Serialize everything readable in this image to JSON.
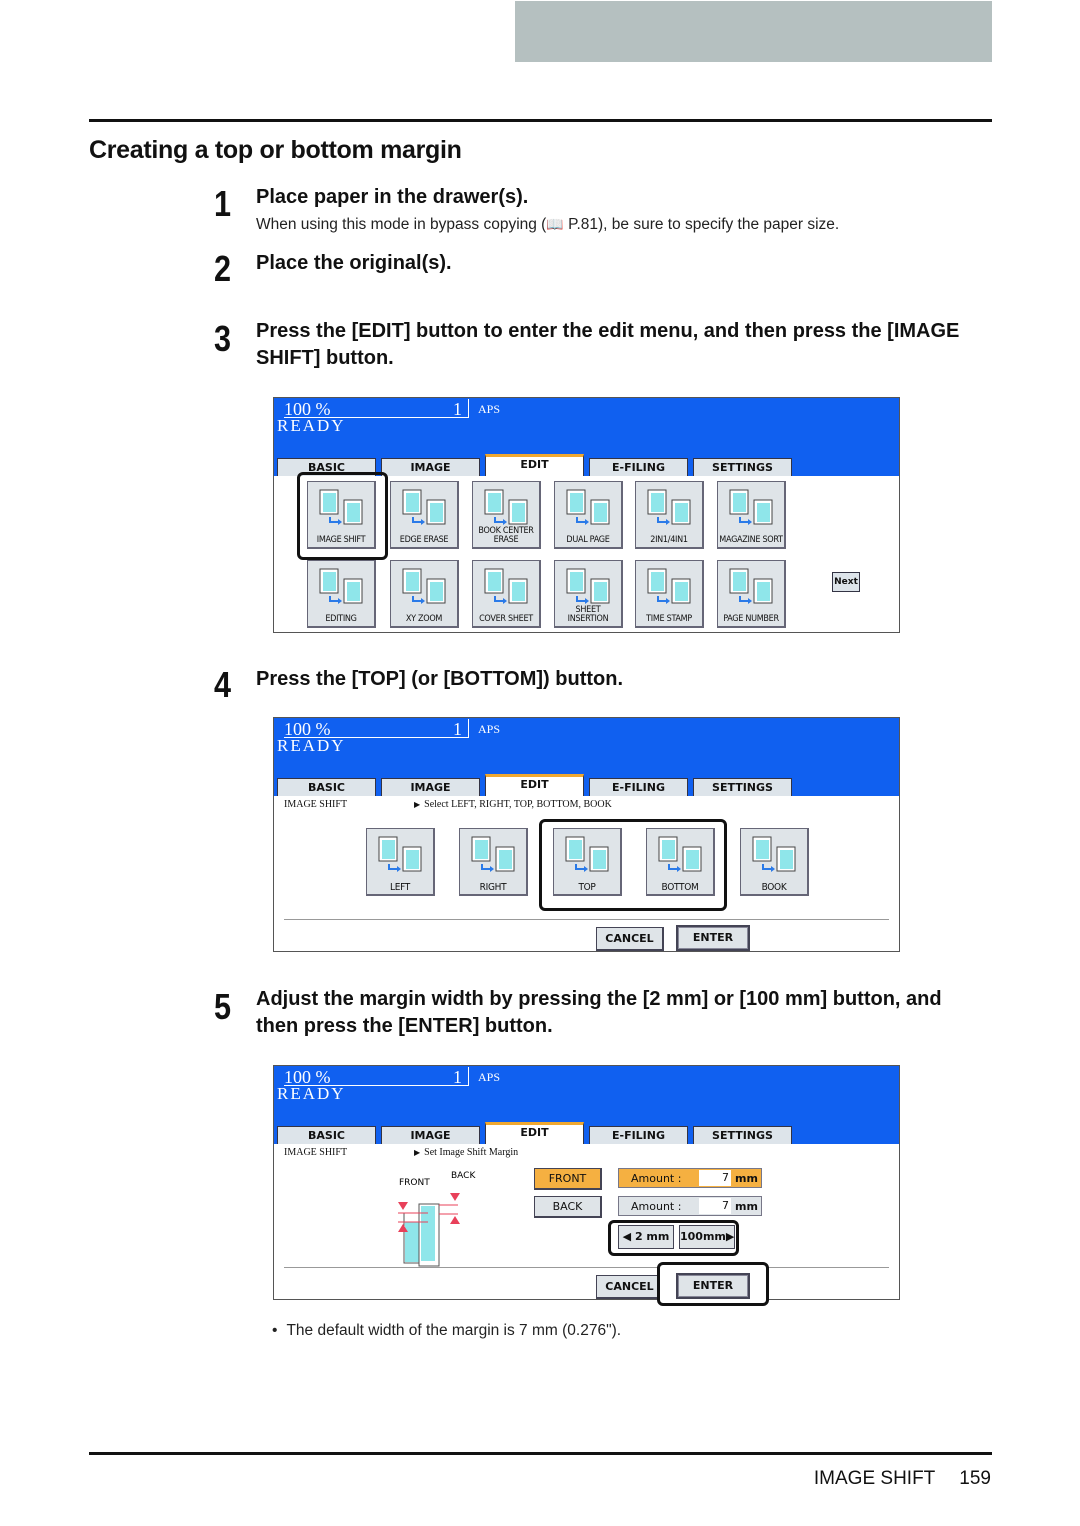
{
  "section_title": "Creating a top or bottom margin",
  "steps": [
    {
      "num": "1",
      "text": "Place paper in the drawer(s).",
      "sub_before": "When using this mode in bypass copying (",
      "sub_ref": "P.81",
      "sub_after": "), be sure to specify the paper size."
    },
    {
      "num": "2",
      "text": "Place the original(s)."
    },
    {
      "num": "3",
      "text": "Press the [EDIT] button to enter the edit menu, and then press the [IMAGE SHIFT] button."
    },
    {
      "num": "4",
      "text": "Press the [TOP] (or [BOTTOM]) button."
    },
    {
      "num": "5",
      "text": "Adjust the margin width by pressing the [2 mm] or [100 mm] button, and then press the [ENTER] button."
    }
  ],
  "panel_common": {
    "zoom": "100 %",
    "count": "1",
    "paper": "APS",
    "status": "READY",
    "tabs": [
      "BASIC",
      "IMAGE",
      "EDIT",
      "E-FILING",
      "SETTINGS"
    ],
    "active_tab": "EDIT"
  },
  "screen1": {
    "row1": [
      "IMAGE SHIFT",
      "EDGE ERASE",
      "BOOK CENTER ERASE",
      "DUAL PAGE",
      "2IN1/4IN1",
      "MAGAZINE SORT"
    ],
    "row2": [
      "EDITING",
      "XY ZOOM",
      "COVER SHEET",
      "SHEET INSERTION",
      "TIME STAMP",
      "PAGE NUMBER"
    ],
    "next_label": "Next",
    "highlighted": "IMAGE SHIFT"
  },
  "screen2": {
    "crumb": "IMAGE SHIFT",
    "message": "Select LEFT, RIGHT, TOP, BOTTOM, BOOK",
    "options": [
      "LEFT",
      "RIGHT",
      "TOP",
      "BOTTOM",
      "BOOK"
    ],
    "cancel": "CANCEL",
    "enter": "ENTER"
  },
  "screen3": {
    "crumb": "IMAGE SHIFT",
    "message": "Set Image Shift Margin",
    "diagram_front": "FRONT",
    "diagram_back": "BACK",
    "front_button": "FRONT",
    "back_button": "BACK",
    "amount_label": "Amount :",
    "front_amount": "7",
    "back_amount": "7",
    "unit": "mm",
    "dec_button": "2 mm",
    "inc_button": "100mm",
    "cancel": "CANCEL",
    "enter": "ENTER",
    "active_color": "#f5b041"
  },
  "note": "The default width of the margin is 7 mm (0.276\").",
  "footer": {
    "section": "IMAGE SHIFT",
    "page": "159"
  }
}
